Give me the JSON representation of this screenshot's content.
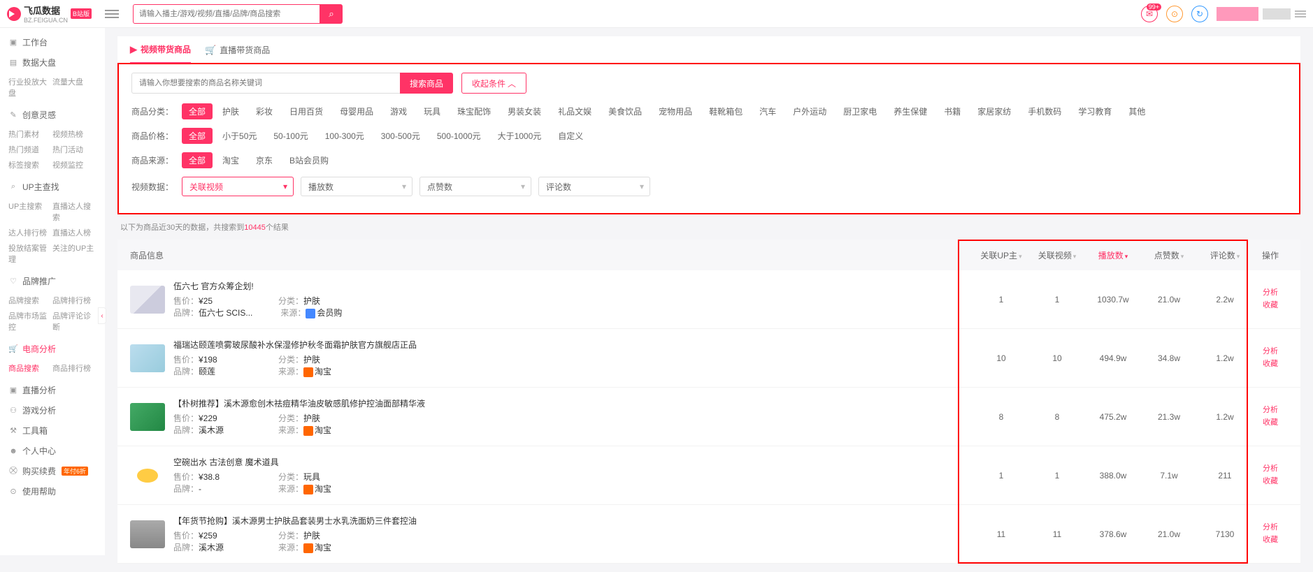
{
  "header": {
    "logo_text": "飞瓜数据",
    "logo_sub": "BZ.FEIGUA.CN",
    "logo_badge": "B站版",
    "search_placeholder": "请输入播主/游戏/视频/直播/品牌/商品搜索",
    "msg_badge": "99+"
  },
  "sidebar": [
    {
      "icon": "▣",
      "label": "工作台",
      "subs": []
    },
    {
      "icon": "▤",
      "label": "数据大盘",
      "subs": [
        "行业投放大盘",
        "流量大盘"
      ]
    },
    {
      "icon": "✎",
      "label": "创意灵感",
      "subs": [
        "热门素材",
        "视频热榜",
        "热门频道",
        "热门活动",
        "标签搜索",
        "视频监控"
      ]
    },
    {
      "icon": "⌕",
      "label": "UP主查找",
      "subs": [
        "UP主搜索",
        "直播达人搜索",
        "达人排行榜",
        "直播达人榜",
        "投放结案管理",
        "关注的UP主"
      ]
    },
    {
      "icon": "♡",
      "label": "品牌推广",
      "subs": [
        "品牌搜索",
        "品牌排行榜",
        "品牌市场监控",
        "品牌评论诊断"
      ]
    },
    {
      "icon": "🛒",
      "label": "电商分析",
      "active": true,
      "subs": [
        "商品搜索",
        "商品排行榜"
      ],
      "sub_active": 0
    },
    {
      "icon": "▣",
      "label": "直播分析",
      "subs": []
    },
    {
      "icon": "⚇",
      "label": "游戏分析",
      "subs": []
    },
    {
      "icon": "⚒",
      "label": "工具箱",
      "subs": []
    },
    {
      "icon": "☻",
      "label": "个人中心",
      "subs": []
    },
    {
      "icon": "⛒",
      "label": "购买续费",
      "badge": "年付6折",
      "subs": []
    },
    {
      "icon": "⊙",
      "label": "使用帮助",
      "subs": []
    }
  ],
  "tabs": [
    {
      "icon": "▶",
      "label": "视频带货商品",
      "active": true
    },
    {
      "icon": "🛒",
      "label": "直播带货商品"
    }
  ],
  "filters": {
    "search_placeholder": "请输入你想要搜索的商品名称关键词",
    "search_btn": "搜索商品",
    "collapse_btn": "收起条件",
    "rows": [
      {
        "label": "商品分类：",
        "opts": [
          "全部",
          "护肤",
          "彩妆",
          "日用百货",
          "母婴用品",
          "游戏",
          "玩具",
          "珠宝配饰",
          "男装女装",
          "礼品文娱",
          "美食饮品",
          "宠物用品",
          "鞋靴箱包",
          "汽车",
          "户外运动",
          "厨卫家电",
          "养生保健",
          "书籍",
          "家居家纺",
          "手机数码",
          "学习教育",
          "其他"
        ]
      },
      {
        "label": "商品价格：",
        "opts": [
          "全部",
          "小于50元",
          "50-100元",
          "100-300元",
          "300-500元",
          "500-1000元",
          "大于1000元",
          "自定义"
        ]
      },
      {
        "label": "商品来源：",
        "opts": [
          "全部",
          "淘宝",
          "京东",
          "B站会员购"
        ]
      }
    ],
    "video_label": "视频数据：",
    "selects": [
      "关联视频",
      "播放数",
      "点赞数",
      "评论数"
    ]
  },
  "hint_prefix": "以下为商品近30天的数据，共搜索到",
  "hint_count": "10445",
  "hint_suffix": "个结果",
  "columns": {
    "info": "商品信息",
    "up": "关联UP主",
    "vid": "关联视频",
    "play": "播放数",
    "like": "点赞数",
    "cmt": "评论数",
    "act": "操作"
  },
  "rows": [
    {
      "thumb": "t1",
      "title": "伍六七 官方众筹企划!",
      "price": "¥25",
      "cat": "护肤",
      "brand": "伍六七 SCIS...",
      "src": "hy",
      "src_txt": "会员购",
      "up": "1",
      "vid": "1",
      "play": "1030.7w",
      "like": "21.0w",
      "cmt": "2.2w"
    },
    {
      "thumb": "t2",
      "title": "福瑞达颐莲喷雾玻尿酸补水保湿修护秋冬面霜护肤官方旗舰店正品",
      "price": "¥198",
      "cat": "护肤",
      "brand": "颐莲",
      "src": "tb",
      "src_txt": "淘宝",
      "up": "10",
      "vid": "10",
      "play": "494.9w",
      "like": "34.8w",
      "cmt": "1.2w"
    },
    {
      "thumb": "t3",
      "title": "【朴树推荐】溪木源愈创木祛痘精华油皮敏感肌修护控油面部精华液",
      "price": "¥229",
      "cat": "护肤",
      "brand": "溪木源",
      "src": "tb",
      "src_txt": "淘宝",
      "up": "8",
      "vid": "8",
      "play": "475.2w",
      "like": "21.3w",
      "cmt": "1.2w"
    },
    {
      "thumb": "t4",
      "title": "空碗出水 古法创意 魔术道具",
      "price": "¥38.8",
      "cat": "玩具",
      "brand": "-",
      "src": "tb",
      "src_txt": "淘宝",
      "up": "1",
      "vid": "1",
      "play": "388.0w",
      "like": "7.1w",
      "cmt": "211"
    },
    {
      "thumb": "t5",
      "title": "【年货节抢购】溪木源男士护肤品套装男士水乳洗面奶三件套控油",
      "price": "¥259",
      "cat": "护肤",
      "brand": "溪木源",
      "src": "tb",
      "src_txt": "淘宝",
      "up": "11",
      "vid": "11",
      "play": "378.6w",
      "like": "21.0w",
      "cmt": "7130"
    }
  ],
  "act": {
    "analyze": "分析",
    "fav": "收藏"
  },
  "meta_labels": {
    "price": "售价：",
    "cat": "分类：",
    "brand": "品牌：",
    "src": "来源："
  }
}
